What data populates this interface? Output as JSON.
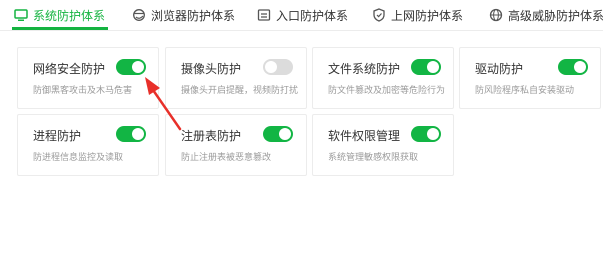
{
  "tabs": [
    {
      "label": "系统防护体系",
      "active": true
    },
    {
      "label": "浏览器防护体系",
      "active": false
    },
    {
      "label": "入口防护体系",
      "active": false
    },
    {
      "label": "上网防护体系",
      "active": false
    },
    {
      "label": "高级威胁防护体系",
      "active": false
    }
  ],
  "cards": [
    {
      "title": "网络安全防护",
      "desc": "防御黑客攻击及木马危害",
      "enabled": true
    },
    {
      "title": "摄像头防护",
      "desc": "摄像头开启提醒，视频防打扰",
      "enabled": false
    },
    {
      "title": "文件系统防护",
      "desc": "防文件篡改及加密等危险行为",
      "enabled": true
    },
    {
      "title": "驱动防护",
      "desc": "防风险程序私自安装驱动",
      "enabled": true
    },
    {
      "title": "进程防护",
      "desc": "防进程信息监控及读取",
      "enabled": true
    },
    {
      "title": "注册表防护",
      "desc": "防止注册表被恶意篡改",
      "enabled": true
    },
    {
      "title": "软件权限管理",
      "desc": "系统管理敏感权限获取",
      "enabled": true
    }
  ],
  "colors": {
    "accent": "#14b340",
    "toggle_on": "#12b544",
    "toggle_off": "#dcdcdc",
    "arrow": "#e8302a"
  },
  "icons": {
    "tab_0": "monitor-icon",
    "tab_1": "browser-icon",
    "tab_2": "entry-icon",
    "tab_3": "shield-icon",
    "tab_4": "globe-icon"
  }
}
